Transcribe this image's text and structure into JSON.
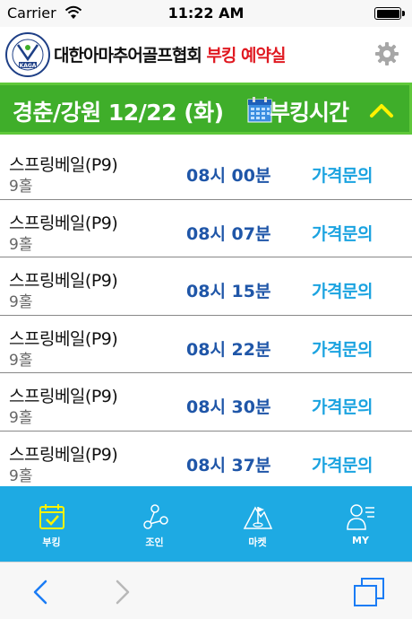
{
  "status_bar": {
    "carrier": "Carrier",
    "time": "11:22 AM"
  },
  "header": {
    "title_main": "대한아마추어골프협회",
    "title_accent": "부킹 예약실",
    "logo_text": "KAGA"
  },
  "banner": {
    "region_date": "경춘/강원 12/22 (화)",
    "label": "부킹시간"
  },
  "rows": [
    {
      "name": "스프링베일(P9)",
      "holes": "9홀",
      "time": "08시 00분",
      "price": "가격문의"
    },
    {
      "name": "스프링베일(P9)",
      "holes": "9홀",
      "time": "08시 07분",
      "price": "가격문의"
    },
    {
      "name": "스프링베일(P9)",
      "holes": "9홀",
      "time": "08시 15분",
      "price": "가격문의"
    },
    {
      "name": "스프링베일(P9)",
      "holes": "9홀",
      "time": "08시 22분",
      "price": "가격문의"
    },
    {
      "name": "스프링베일(P9)",
      "holes": "9홀",
      "time": "08시 30분",
      "price": "가격문의"
    },
    {
      "name": "스프링베일(P9)",
      "holes": "9홀",
      "time": "08시 37분",
      "price": "가격문의"
    }
  ],
  "tabbar": {
    "tabs": [
      {
        "label": "부킹",
        "icon": "calendar-check-icon"
      },
      {
        "label": "조인",
        "icon": "share-nodes-icon"
      },
      {
        "label": "마켓",
        "icon": "golf-flag-icon"
      },
      {
        "label": "MY",
        "icon": "user-icon"
      }
    ]
  },
  "colors": {
    "banner_green": "#3fae2a",
    "tabbar_blue": "#1eaae3",
    "time_blue": "#1f56a8",
    "price_blue": "#1ba3e0",
    "accent_red": "#e01a22"
  }
}
